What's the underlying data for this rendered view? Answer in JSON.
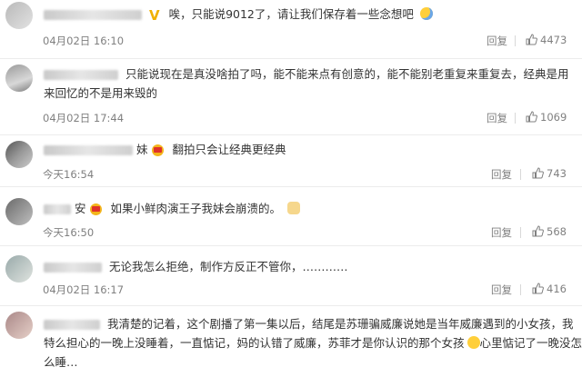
{
  "comments": [
    {
      "name_redacted": true,
      "badge": "v-icon",
      "text": "唉，只能说9012了，请让我们保存着一些念想吧",
      "emoji": "crying-emoji",
      "time": "04月02日 16:10",
      "reply_label": "回复",
      "likes": "4473"
    },
    {
      "name_redacted": true,
      "badge": "",
      "text_line1": "只能说现在是真没啥拍了吗，能不能来点有创意的，能不能别老重复来重复去，经典是用",
      "text_line2": "来回忆的不是用来毁的",
      "time": "04月02日 17:44",
      "reply_label": "回复",
      "likes": "1069"
    },
    {
      "name_redacted": true,
      "name_suffix": "妹",
      "badge": "crown-icon",
      "text": "翻拍只会让经典更经典",
      "time": "今天16:54",
      "reply_label": "回复",
      "likes": "743"
    },
    {
      "name_redacted": true,
      "name_suffix": "安",
      "badge": "crown-icon",
      "text": "如果小鲜肉演王子我妹会崩溃的。",
      "emoji": "dog-emoji",
      "time": "今天16:50",
      "reply_label": "回复",
      "likes": "568"
    },
    {
      "name_redacted": true,
      "badge": "",
      "text": "无论我怎么拒绝，制作方反正不管你，…………",
      "time": "04月02日 16:17",
      "reply_label": "回复",
      "likes": "416"
    },
    {
      "name_redacted": true,
      "badge": "",
      "text_line1": "我清楚的记着，这个剧播了第一集以后，结尾是苏珊骗威廉说她是当年威廉遇到的小女孩，我",
      "text_line2": "特么担心的一晚上没睡着，一直惦记，妈的认错了威廉，苏菲才是你认识的那个女孩",
      "text_line2b": "心里惦记了一晚没怎",
      "text_line3": "么睡…",
      "emoji": "laughing-emoji"
    }
  ]
}
